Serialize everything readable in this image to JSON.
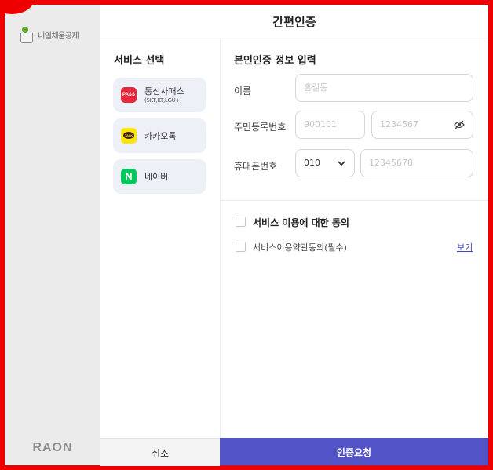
{
  "app": {
    "title": "간편인증",
    "brand_text": "내일채움공제",
    "vendor_logo": "RAON"
  },
  "services": {
    "heading": "서비스 선택",
    "items": [
      {
        "label": "통신사패스",
        "sublabel": "(SKT,KT,LGU+)",
        "icon": "pass-icon",
        "icon_text": "PASS"
      },
      {
        "label": "카카오톡",
        "icon": "kakao-icon",
        "icon_text": "TALK"
      },
      {
        "label": "네이버",
        "icon": "naver-icon",
        "icon_text": "N"
      }
    ]
  },
  "form": {
    "heading": "본인인증 정보 입력",
    "name_label": "이름",
    "name_placeholder": "홍길동",
    "rrn_label": "주민등록번호",
    "rrn_front_placeholder": "900101",
    "rrn_back_placeholder": "1234567",
    "phone_label": "휴대폰번호",
    "carrier_value": "010",
    "phone_placeholder": "12345678"
  },
  "agreement": {
    "title": "서비스 이용에 대한 동의",
    "item_label": "서비스이용약관동의(필수)",
    "view_link": "보기"
  },
  "buttons": {
    "cancel": "취소",
    "submit": "인증요청"
  },
  "colors": {
    "accent": "#5253c7",
    "frame": "#ee0000",
    "pass": "#e8263c",
    "kakao": "#fee500",
    "naver": "#03c75a"
  }
}
